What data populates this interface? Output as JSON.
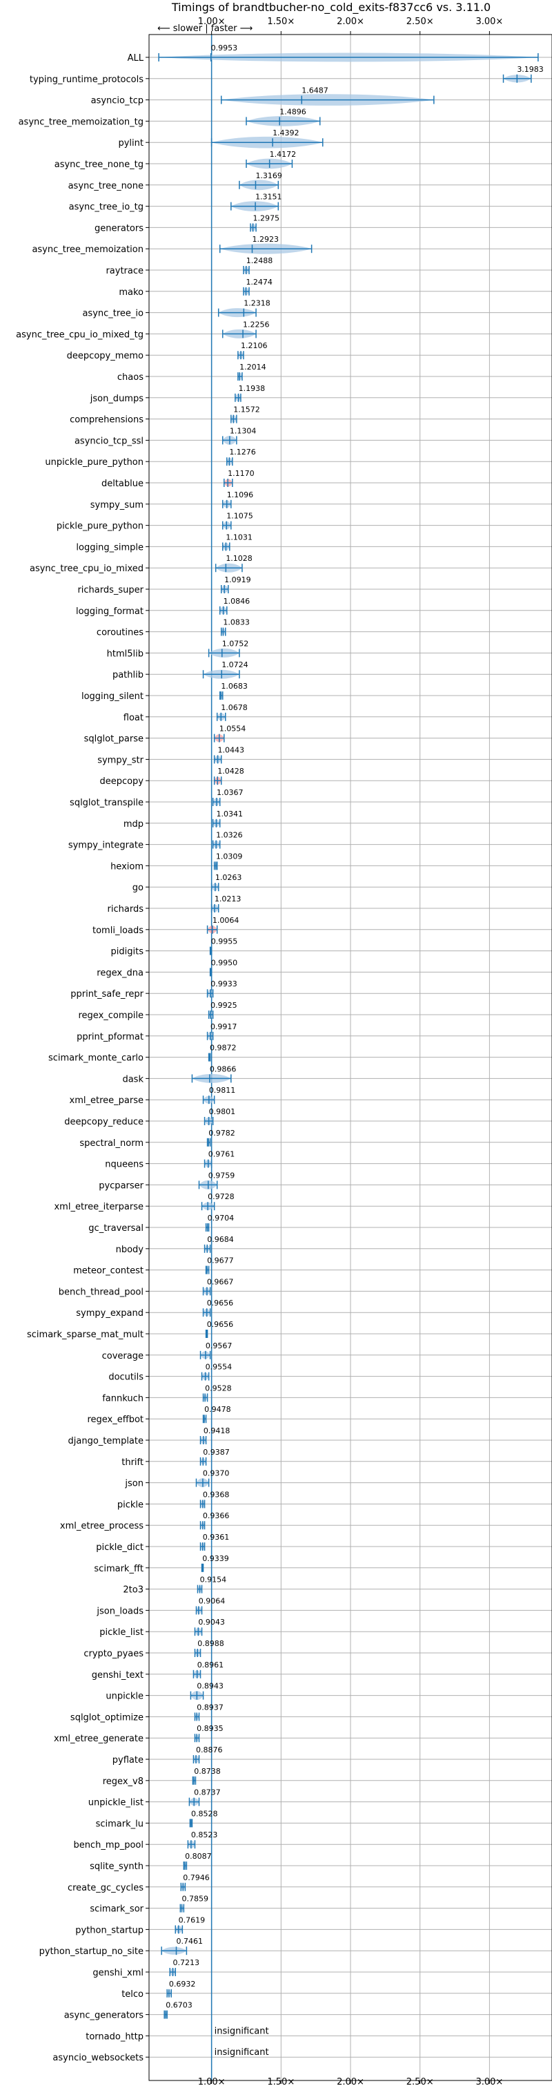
{
  "chart_data": {
    "type": "violin",
    "title": "Timings of brandtbucher-no_cold_exits-f837cc6 vs. 3.11.0",
    "direction_label": "⟵ slower | faster ⟶",
    "x_ticks": [
      1.0,
      1.5,
      2.0,
      2.5,
      3.0
    ],
    "x_tick_labels": [
      "1.00×",
      "1.50×",
      "2.00×",
      "2.50×",
      "3.00×"
    ],
    "xlim": [
      0.55,
      3.45
    ],
    "grid": true,
    "baseline": 1.0,
    "insignificant_label": "insignificant",
    "colors": {
      "violin": "#a9c8e4",
      "line": "#1f77b4",
      "axis": "#000000",
      "grid": "#b0b0b0",
      "highlight": "#ff7f7f"
    },
    "benchmarks": [
      {
        "name": "ALL",
        "value": 0.9953,
        "label": "0.9953",
        "lo": 0.62,
        "hi": 3.35,
        "w": 0.35
      },
      {
        "name": "typing_runtime_protocols",
        "value": 3.1983,
        "label": "3.1983",
        "lo": 3.1,
        "hi": 3.3,
        "w": 0.3
      },
      {
        "name": "asyncio_tcp",
        "value": 1.6487,
        "label": "1.6487",
        "lo": 1.07,
        "hi": 2.6,
        "w": 0.45
      },
      {
        "name": "async_tree_memoization_tg",
        "value": 1.4896,
        "label": "1.4896",
        "lo": 1.25,
        "hi": 1.78,
        "w": 0.4
      },
      {
        "name": "pylint",
        "value": 1.4392,
        "label": "1.4392",
        "lo": 1.0,
        "hi": 1.8,
        "w": 0.45
      },
      {
        "name": "async_tree_none_tg",
        "value": 1.4172,
        "label": "1.4172",
        "lo": 1.25,
        "hi": 1.58,
        "w": 0.4
      },
      {
        "name": "async_tree_none",
        "value": 1.3169,
        "label": "1.3169",
        "lo": 1.2,
        "hi": 1.48,
        "w": 0.4
      },
      {
        "name": "async_tree_io_tg",
        "value": 1.3151,
        "label": "1.3151",
        "lo": 1.14,
        "hi": 1.48,
        "w": 0.4
      },
      {
        "name": "generators",
        "value": 1.2975,
        "label": "1.2975",
        "lo": 1.28,
        "hi": 1.32,
        "w": 0.3
      },
      {
        "name": "async_tree_memoization",
        "value": 1.2923,
        "label": "1.2923",
        "lo": 1.06,
        "hi": 1.72,
        "w": 0.4
      },
      {
        "name": "raytrace",
        "value": 1.2488,
        "label": "1.2488",
        "lo": 1.23,
        "hi": 1.27,
        "w": 0.3
      },
      {
        "name": "mako",
        "value": 1.2474,
        "label": "1.2474",
        "lo": 1.23,
        "hi": 1.27,
        "w": 0.3
      },
      {
        "name": "async_tree_io",
        "value": 1.2318,
        "label": "1.2318",
        "lo": 1.05,
        "hi": 1.32,
        "w": 0.35
      },
      {
        "name": "async_tree_cpu_io_mixed_tg",
        "value": 1.2256,
        "label": "1.2256",
        "lo": 1.08,
        "hi": 1.32,
        "w": 0.35
      },
      {
        "name": "deepcopy_memo",
        "value": 1.2106,
        "label": "1.2106",
        "lo": 1.19,
        "hi": 1.23,
        "w": 0.3
      },
      {
        "name": "chaos",
        "value": 1.2014,
        "label": "1.2014",
        "lo": 1.19,
        "hi": 1.22,
        "w": 0.3
      },
      {
        "name": "json_dumps",
        "value": 1.1938,
        "label": "1.1938",
        "lo": 1.17,
        "hi": 1.21,
        "w": 0.3
      },
      {
        "name": "comprehensions",
        "value": 1.1572,
        "label": "1.1572",
        "lo": 1.14,
        "hi": 1.18,
        "w": 0.3
      },
      {
        "name": "asyncio_tcp_ssl",
        "value": 1.1304,
        "label": "1.1304",
        "lo": 1.08,
        "hi": 1.18,
        "w": 0.35
      },
      {
        "name": "unpickle_pure_python",
        "value": 1.1276,
        "label": "1.1276",
        "lo": 1.11,
        "hi": 1.15,
        "w": 0.3
      },
      {
        "name": "deltablue",
        "value": 1.117,
        "label": "1.1170",
        "lo": 1.09,
        "hi": 1.15,
        "w": 0.3,
        "highlight": true
      },
      {
        "name": "sympy_sum",
        "value": 1.1096,
        "label": "1.1096",
        "lo": 1.08,
        "hi": 1.14,
        "w": 0.3
      },
      {
        "name": "pickle_pure_python",
        "value": 1.1075,
        "label": "1.1075",
        "lo": 1.08,
        "hi": 1.14,
        "w": 0.3
      },
      {
        "name": "logging_simple",
        "value": 1.1031,
        "label": "1.1031",
        "lo": 1.08,
        "hi": 1.13,
        "w": 0.3
      },
      {
        "name": "async_tree_cpu_io_mixed",
        "value": 1.1028,
        "label": "1.1028",
        "lo": 1.03,
        "hi": 1.22,
        "w": 0.35
      },
      {
        "name": "richards_super",
        "value": 1.0919,
        "label": "1.0919",
        "lo": 1.07,
        "hi": 1.12,
        "w": 0.3
      },
      {
        "name": "logging_format",
        "value": 1.0846,
        "label": "1.0846",
        "lo": 1.06,
        "hi": 1.11,
        "w": 0.3
      },
      {
        "name": "coroutines",
        "value": 1.0833,
        "label": "1.0833",
        "lo": 1.07,
        "hi": 1.1,
        "w": 0.25
      },
      {
        "name": "html5lib",
        "value": 1.0752,
        "label": "1.0752",
        "lo": 0.98,
        "hi": 1.2,
        "w": 0.35
      },
      {
        "name": "pathlib",
        "value": 1.0724,
        "label": "1.0724",
        "lo": 0.94,
        "hi": 1.2,
        "w": 0.35
      },
      {
        "name": "logging_silent",
        "value": 1.0683,
        "label": "1.0683",
        "lo": 1.06,
        "hi": 1.08,
        "w": 0.25
      },
      {
        "name": "float",
        "value": 1.0678,
        "label": "1.0678",
        "lo": 1.04,
        "hi": 1.1,
        "w": 0.3
      },
      {
        "name": "sqlglot_parse",
        "value": 1.0554,
        "label": "1.0554",
        "lo": 1.02,
        "hi": 1.09,
        "w": 0.3,
        "highlight": true
      },
      {
        "name": "sympy_str",
        "value": 1.0443,
        "label": "1.0443",
        "lo": 1.02,
        "hi": 1.07,
        "w": 0.3
      },
      {
        "name": "deepcopy",
        "value": 1.0428,
        "label": "1.0428",
        "lo": 1.02,
        "hi": 1.07,
        "w": 0.3,
        "highlight": true
      },
      {
        "name": "sqlglot_transpile",
        "value": 1.0367,
        "label": "1.0367",
        "lo": 1.01,
        "hi": 1.06,
        "w": 0.3
      },
      {
        "name": "mdp",
        "value": 1.0341,
        "label": "1.0341",
        "lo": 1.01,
        "hi": 1.06,
        "w": 0.3
      },
      {
        "name": "sympy_integrate",
        "value": 1.0326,
        "label": "1.0326",
        "lo": 1.01,
        "hi": 1.06,
        "w": 0.3
      },
      {
        "name": "hexiom",
        "value": 1.0309,
        "label": "1.0309",
        "lo": 1.02,
        "hi": 1.04,
        "w": 0.25
      },
      {
        "name": "go",
        "value": 1.0263,
        "label": "1.0263",
        "lo": 1.0,
        "hi": 1.05,
        "w": 0.3
      },
      {
        "name": "richards",
        "value": 1.0213,
        "label": "1.0213",
        "lo": 1.0,
        "hi": 1.05,
        "w": 0.3
      },
      {
        "name": "tomli_loads",
        "value": 1.0064,
        "label": "1.0064",
        "lo": 0.97,
        "hi": 1.04,
        "w": 0.3,
        "highlight": true
      },
      {
        "name": "pidigits",
        "value": 0.9955,
        "label": "0.9955",
        "lo": 0.99,
        "hi": 1.0,
        "w": 0.2
      },
      {
        "name": "regex_dna",
        "value": 0.995,
        "label": "0.9950",
        "lo": 0.99,
        "hi": 1.0,
        "w": 0.2
      },
      {
        "name": "pprint_safe_repr",
        "value": 0.9933,
        "label": "0.9933",
        "lo": 0.97,
        "hi": 1.01,
        "w": 0.3
      },
      {
        "name": "regex_compile",
        "value": 0.9925,
        "label": "0.9925",
        "lo": 0.98,
        "hi": 1.01,
        "w": 0.25
      },
      {
        "name": "pprint_pformat",
        "value": 0.9917,
        "label": "0.9917",
        "lo": 0.97,
        "hi": 1.01,
        "w": 0.3
      },
      {
        "name": "scimark_monte_carlo",
        "value": 0.9872,
        "label": "0.9872",
        "lo": 0.98,
        "hi": 0.99,
        "w": 0.2
      },
      {
        "name": "dask",
        "value": 0.9866,
        "label": "0.9866",
        "lo": 0.86,
        "hi": 1.14,
        "w": 0.35
      },
      {
        "name": "xml_etree_parse",
        "value": 0.9811,
        "label": "0.9811",
        "lo": 0.94,
        "hi": 1.02,
        "w": 0.3
      },
      {
        "name": "deepcopy_reduce",
        "value": 0.9801,
        "label": "0.9801",
        "lo": 0.95,
        "hi": 1.01,
        "w": 0.3
      },
      {
        "name": "spectral_norm",
        "value": 0.9782,
        "label": "0.9782",
        "lo": 0.97,
        "hi": 0.99,
        "w": 0.2
      },
      {
        "name": "nqueens",
        "value": 0.9761,
        "label": "0.9761",
        "lo": 0.95,
        "hi": 1.0,
        "w": 0.3
      },
      {
        "name": "pycparser",
        "value": 0.9759,
        "label": "0.9759",
        "lo": 0.91,
        "hi": 1.04,
        "w": 0.35
      },
      {
        "name": "xml_etree_iterparse",
        "value": 0.9728,
        "label": "0.9728",
        "lo": 0.93,
        "hi": 1.02,
        "w": 0.3
      },
      {
        "name": "gc_traversal",
        "value": 0.9704,
        "label": "0.9704",
        "lo": 0.96,
        "hi": 0.98,
        "w": 0.2
      },
      {
        "name": "nbody",
        "value": 0.9684,
        "label": "0.9684",
        "lo": 0.95,
        "hi": 0.99,
        "w": 0.25
      },
      {
        "name": "meteor_contest",
        "value": 0.9677,
        "label": "0.9677",
        "lo": 0.96,
        "hi": 0.98,
        "w": 0.2
      },
      {
        "name": "bench_thread_pool",
        "value": 0.9667,
        "label": "0.9667",
        "lo": 0.94,
        "hi": 0.99,
        "w": 0.3
      },
      {
        "name": "sympy_expand",
        "value": 0.9656,
        "label": "0.9656",
        "lo": 0.94,
        "hi": 0.99,
        "w": 0.3
      },
      {
        "name": "scimark_sparse_mat_mult",
        "value": 0.9656,
        "label": "0.9656",
        "lo": 0.96,
        "hi": 0.97,
        "w": 0.2
      },
      {
        "name": "coverage",
        "value": 0.9567,
        "label": "0.9567",
        "lo": 0.92,
        "hi": 0.99,
        "w": 0.3
      },
      {
        "name": "docutils",
        "value": 0.9554,
        "label": "0.9554",
        "lo": 0.93,
        "hi": 0.98,
        "w": 0.3
      },
      {
        "name": "fannkuch",
        "value": 0.9528,
        "label": "0.9528",
        "lo": 0.94,
        "hi": 0.97,
        "w": 0.25
      },
      {
        "name": "regex_effbot",
        "value": 0.9478,
        "label": "0.9478",
        "lo": 0.94,
        "hi": 0.96,
        "w": 0.2
      },
      {
        "name": "django_template",
        "value": 0.9418,
        "label": "0.9418",
        "lo": 0.92,
        "hi": 0.96,
        "w": 0.3
      },
      {
        "name": "thrift",
        "value": 0.9387,
        "label": "0.9387",
        "lo": 0.92,
        "hi": 0.96,
        "w": 0.25
      },
      {
        "name": "json",
        "value": 0.937,
        "label": "0.9370",
        "lo": 0.89,
        "hi": 0.98,
        "w": 0.35
      },
      {
        "name": "pickle",
        "value": 0.9368,
        "label": "0.9368",
        "lo": 0.92,
        "hi": 0.95,
        "w": 0.3
      },
      {
        "name": "xml_etree_process",
        "value": 0.9366,
        "label": "0.9366",
        "lo": 0.92,
        "hi": 0.95,
        "w": 0.25
      },
      {
        "name": "pickle_dict",
        "value": 0.9361,
        "label": "0.9361",
        "lo": 0.92,
        "hi": 0.95,
        "w": 0.3
      },
      {
        "name": "scimark_fft",
        "value": 0.9339,
        "label": "0.9339",
        "lo": 0.93,
        "hi": 0.94,
        "w": 0.2
      },
      {
        "name": "2to3",
        "value": 0.9154,
        "label": "0.9154",
        "lo": 0.9,
        "hi": 0.93,
        "w": 0.25
      },
      {
        "name": "json_loads",
        "value": 0.9064,
        "label": "0.9064",
        "lo": 0.89,
        "hi": 0.93,
        "w": 0.3
      },
      {
        "name": "pickle_list",
        "value": 0.9043,
        "label": "0.9043",
        "lo": 0.88,
        "hi": 0.93,
        "w": 0.3
      },
      {
        "name": "crypto_pyaes",
        "value": 0.8988,
        "label": "0.8988",
        "lo": 0.88,
        "hi": 0.92,
        "w": 0.3
      },
      {
        "name": "genshi_text",
        "value": 0.8961,
        "label": "0.8961",
        "lo": 0.87,
        "hi": 0.92,
        "w": 0.3
      },
      {
        "name": "unpickle",
        "value": 0.8943,
        "label": "0.8943",
        "lo": 0.85,
        "hi": 0.94,
        "w": 0.35
      },
      {
        "name": "sqlglot_optimize",
        "value": 0.8937,
        "label": "0.8937",
        "lo": 0.88,
        "hi": 0.91,
        "w": 0.25
      },
      {
        "name": "xml_etree_generate",
        "value": 0.8935,
        "label": "0.8935",
        "lo": 0.88,
        "hi": 0.91,
        "w": 0.25
      },
      {
        "name": "pyflate",
        "value": 0.8876,
        "label": "0.8876",
        "lo": 0.87,
        "hi": 0.91,
        "w": 0.3
      },
      {
        "name": "regex_v8",
        "value": 0.8738,
        "label": "0.8738",
        "lo": 0.865,
        "hi": 0.885,
        "w": 0.2
      },
      {
        "name": "unpickle_list",
        "value": 0.8737,
        "label": "0.8737",
        "lo": 0.84,
        "hi": 0.91,
        "w": 0.3
      },
      {
        "name": "scimark_lu",
        "value": 0.8528,
        "label": "0.8528",
        "lo": 0.845,
        "hi": 0.86,
        "w": 0.2
      },
      {
        "name": "bench_mp_pool",
        "value": 0.8523,
        "label": "0.8523",
        "lo": 0.83,
        "hi": 0.88,
        "w": 0.3
      },
      {
        "name": "sqlite_synth",
        "value": 0.8087,
        "label": "0.8087",
        "lo": 0.8,
        "hi": 0.82,
        "w": 0.2
      },
      {
        "name": "create_gc_cycles",
        "value": 0.7946,
        "label": "0.7946",
        "lo": 0.78,
        "hi": 0.81,
        "w": 0.25
      },
      {
        "name": "scimark_sor",
        "value": 0.7859,
        "label": "0.7859",
        "lo": 0.775,
        "hi": 0.8,
        "w": 0.2
      },
      {
        "name": "python_startup",
        "value": 0.7619,
        "label": "0.7619",
        "lo": 0.74,
        "hi": 0.79,
        "w": 0.3
      },
      {
        "name": "python_startup_no_site",
        "value": 0.7461,
        "label": "0.7461",
        "lo": 0.64,
        "hi": 0.82,
        "w": 0.3
      },
      {
        "name": "genshi_xml",
        "value": 0.7213,
        "label": "0.7213",
        "lo": 0.7,
        "hi": 0.74,
        "w": 0.3
      },
      {
        "name": "telco",
        "value": 0.6932,
        "label": "0.6932",
        "lo": 0.68,
        "hi": 0.71,
        "w": 0.3
      },
      {
        "name": "async_generators",
        "value": 0.6703,
        "label": "0.6703",
        "lo": 0.66,
        "hi": 0.68,
        "w": 0.3
      },
      {
        "name": "tornado_http",
        "value": null,
        "label": "insignificant"
      },
      {
        "name": "asyncio_websockets",
        "value": null,
        "label": "insignificant"
      }
    ]
  }
}
